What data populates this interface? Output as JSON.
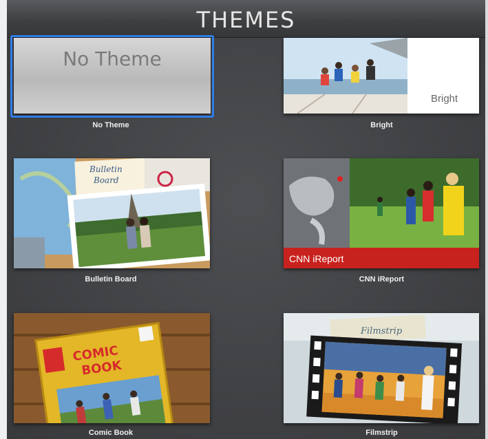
{
  "header": {
    "title": "THEMES"
  },
  "themes": [
    {
      "label": "No Theme",
      "selected": true,
      "thumb_text": "No Theme"
    },
    {
      "label": "Bright",
      "selected": false,
      "thumb_text": "Bright"
    },
    {
      "label": "Bulletin Board",
      "selected": false,
      "thumb_text_line1": "Bulletin",
      "thumb_text_line2": "Board"
    },
    {
      "label": "CNN iReport",
      "selected": false,
      "thumb_text": "CNN iReport"
    },
    {
      "label": "Comic Book",
      "selected": false,
      "thumb_text_line1": "COMIC",
      "thumb_text_line2": "BOOK"
    },
    {
      "label": "Filmstrip",
      "selected": false,
      "thumb_text": "Filmstrip"
    }
  ],
  "colors": {
    "selection": "#2f7ee8",
    "background": "#3b3c3e",
    "cnn_red": "#c8221e"
  }
}
